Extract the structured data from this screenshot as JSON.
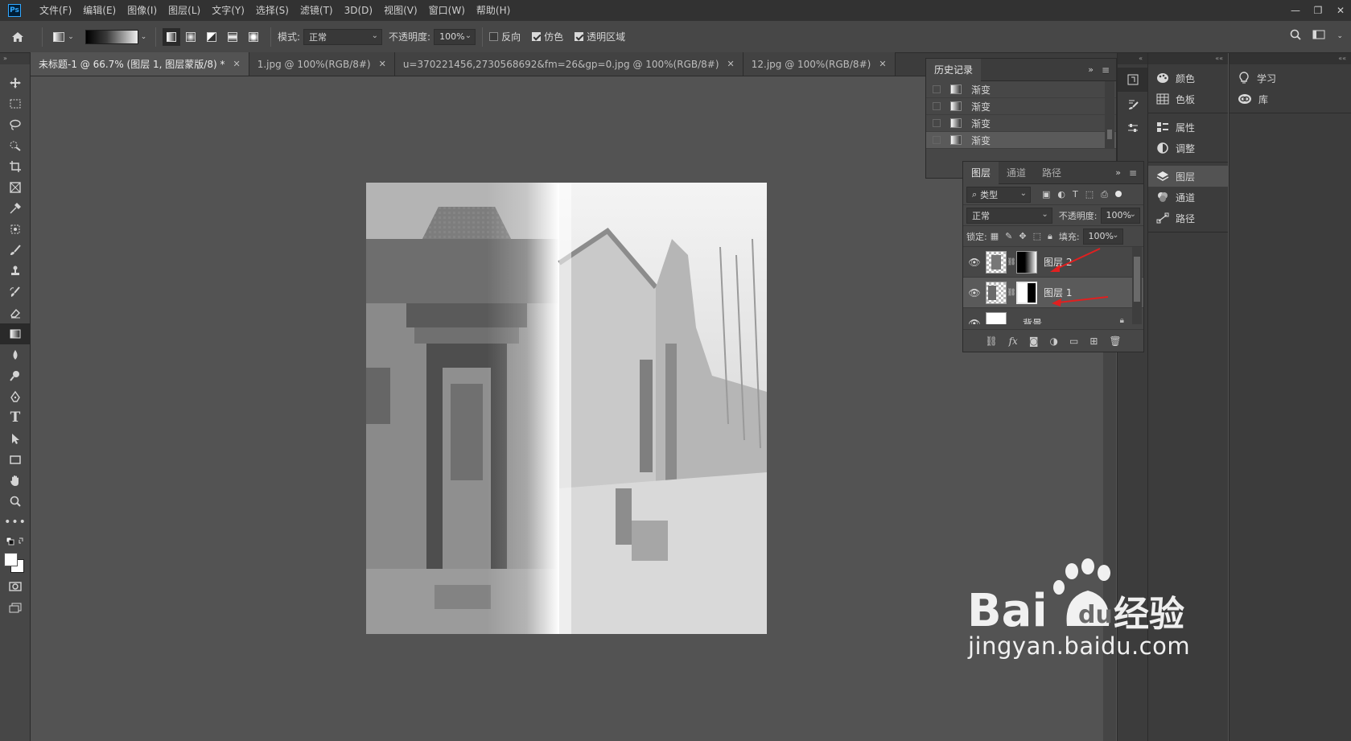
{
  "app": {
    "logo_text": "Ps"
  },
  "menu": [
    "文件(F)",
    "编辑(E)",
    "图像(I)",
    "图层(L)",
    "文字(Y)",
    "选择(S)",
    "滤镜(T)",
    "3D(D)",
    "视图(V)",
    "窗口(W)",
    "帮助(H)"
  ],
  "options": {
    "mode_label": "模式:",
    "mode_value": "正常",
    "opacity_label": "不透明度:",
    "opacity_value": "100%",
    "reverse_label": "反向",
    "reverse_checked": false,
    "dither_label": "仿色",
    "dither_checked": true,
    "transparency_label": "透明区域",
    "transparency_checked": true
  },
  "tabs": [
    {
      "label": "未标题-1 @ 66.7% (图层 1, 图层蒙版/8) *",
      "active": true
    },
    {
      "label": "1.jpg @ 100%(RGB/8#)",
      "active": false
    },
    {
      "label": "u=370221456,2730568692&fm=26&gp=0.jpg @ 100%(RGB/8#)",
      "active": false
    },
    {
      "label": "12.jpg @ 100%(RGB/8#)",
      "active": false
    }
  ],
  "history": {
    "title": "历史记录",
    "items": [
      {
        "label": "渐变",
        "selected": false
      },
      {
        "label": "渐变",
        "selected": false
      },
      {
        "label": "渐变",
        "selected": false
      },
      {
        "label": "渐变",
        "selected": true
      }
    ]
  },
  "layers_panel": {
    "tabs": [
      "图层",
      "通道",
      "路径"
    ],
    "filter_label": "类型",
    "blend_mode": "正常",
    "opacity_label": "不透明度:",
    "opacity_value": "100%",
    "lock_label": "锁定:",
    "fill_label": "填充:",
    "fill_value": "100%",
    "layers": [
      {
        "name": "图层 2",
        "selected": false
      },
      {
        "name": "图层 1",
        "selected": true
      },
      {
        "name": "背景",
        "selected": false
      }
    ]
  },
  "dock2": [
    {
      "label": "颜色",
      "icon": "palette-icon"
    },
    {
      "label": "色板",
      "icon": "swatches-icon"
    },
    {
      "label": "属性",
      "icon": "properties-icon"
    },
    {
      "label": "调整",
      "icon": "adjustments-icon"
    },
    {
      "label": "图层",
      "icon": "layers-icon"
    },
    {
      "label": "通道",
      "icon": "channels-icon"
    },
    {
      "label": "路径",
      "icon": "paths-icon"
    }
  ],
  "dock3": [
    {
      "label": "学习",
      "icon": "lightbulb-icon"
    },
    {
      "label": "库",
      "icon": "cc-libraries-icon"
    }
  ],
  "watermark": {
    "brand": "Bai",
    "brand_cn": "经验",
    "url": "jingyan.baidu.com"
  },
  "colors": {
    "accent_blue": "#31a8ff",
    "arrow_red": "#e02020"
  }
}
